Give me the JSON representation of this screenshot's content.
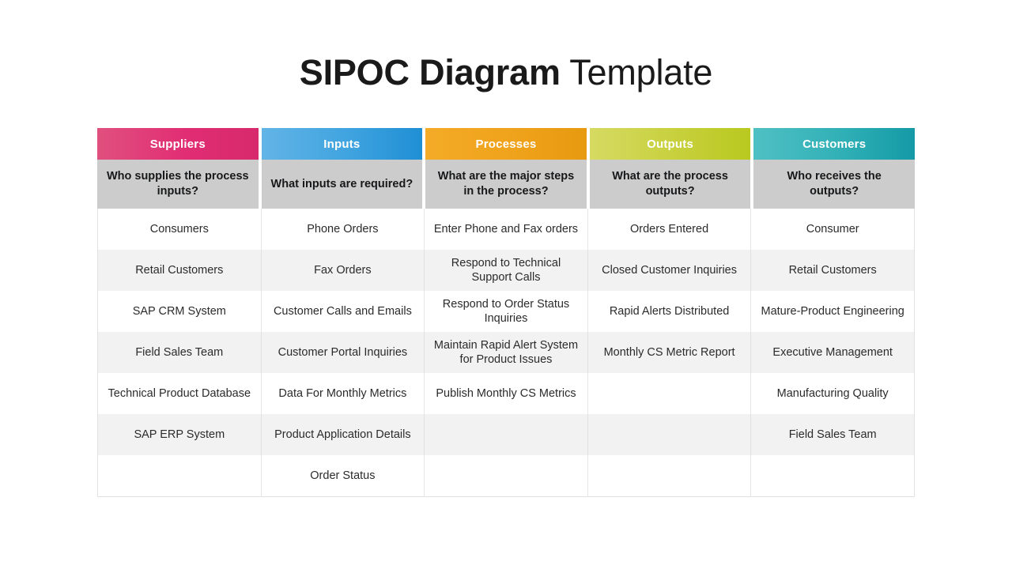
{
  "title": {
    "bold_part": "SIPOC Diagram",
    "light_part": " Template"
  },
  "table": {
    "columns": [
      {
        "header": "Suppliers",
        "question": "Who supplies the process inputs?",
        "accent": "#e12d73"
      },
      {
        "header": "Inputs",
        "question": "What inputs are required?",
        "accent": "#3fa3df"
      },
      {
        "header": "Processes",
        "question": "What are the major steps in the process?",
        "accent": "#efa21b"
      },
      {
        "header": "Outputs",
        "question": "What are the process outputs?",
        "accent": "#c7d03c"
      },
      {
        "header": "Customers",
        "question": "Who receives the outputs?",
        "accent": "#30b0b6"
      }
    ],
    "rows": [
      {
        "suppliers": "Consumers",
        "inputs": "Phone Orders",
        "processes": "Enter Phone and Fax orders",
        "outputs": "Orders Entered",
        "customers": "Consumer"
      },
      {
        "suppliers": "Retail Customers",
        "inputs": "Fax Orders",
        "processes": "Respond to Technical Support Calls",
        "outputs": "Closed Customer Inquiries",
        "customers": "Retail Customers"
      },
      {
        "suppliers": "SAP CRM System",
        "inputs": "Customer Calls and Emails",
        "processes": "Respond to Order Status Inquiries",
        "outputs": "Rapid Alerts Distributed",
        "customers": "Mature-Product Engineering"
      },
      {
        "suppliers": "Field Sales Team",
        "inputs": "Customer Portal Inquiries",
        "processes": "Maintain Rapid Alert System for Product Issues",
        "outputs": "Monthly CS Metric Report",
        "customers": "Executive Management"
      },
      {
        "suppliers": "Technical Product Database",
        "inputs": "Data For Monthly Metrics",
        "processes": "Publish Monthly CS Metrics",
        "outputs": "",
        "customers": "Manufacturing Quality"
      },
      {
        "suppliers": "SAP ERP System",
        "inputs": "Product Application Details",
        "processes": "",
        "outputs": "",
        "customers": "Field Sales Team"
      },
      {
        "suppliers": "",
        "inputs": "Order Status",
        "processes": "",
        "outputs": "",
        "customers": ""
      }
    ]
  }
}
